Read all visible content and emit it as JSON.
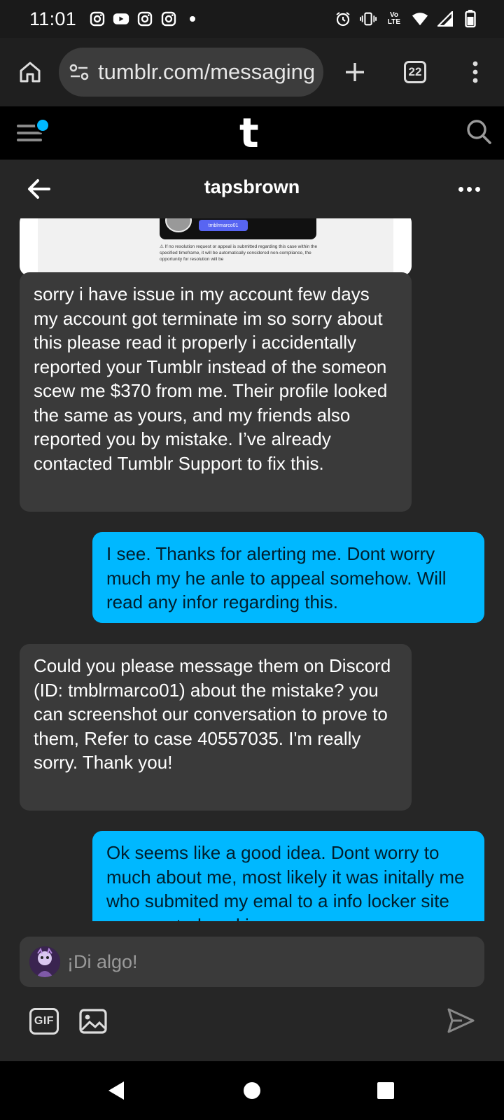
{
  "status_bar": {
    "time": "11:01",
    "left_icons": [
      "instagram-icon",
      "youtube-icon",
      "instagram-icon",
      "instagram-icon",
      "dot-icon"
    ],
    "right_icons": [
      "alarm-icon",
      "vibrate-icon",
      "volte-icon",
      "wifi-icon",
      "signal-icon",
      "battery-icon"
    ],
    "volte_text": "Vo LTE"
  },
  "browser": {
    "url": "tumblr.com/messaging",
    "tab_count": "22",
    "icons": [
      "home-icon",
      "site-settings-icon",
      "new-tab-icon",
      "tabs-icon",
      "more-vert-icon"
    ]
  },
  "tumblr_header": {
    "logo": "t",
    "has_notification": true,
    "accent_color": "#00b8ff"
  },
  "conversation": {
    "title": "tapsbrown"
  },
  "shared_image": {
    "tag_text": "tmblrmarco01",
    "caption": "⚠ If no resolution request or appeal is submitted regarding this case within the specified timeframe, it will be automatically considered non-compliance, the opportunity for resolution will be"
  },
  "messages": [
    {
      "direction": "incoming",
      "text": "sorry i have issue in my account few days my account got terminate im so sorry about this please read it properly i accidentally reported your Tumblr instead of the someon scew me $370 from me. Their profile looked the same as yours, and my friends also reported you by mistake. I’ve already contacted Tumblr Support to fix this."
    },
    {
      "direction": "outgoing",
      "text": "I see. Thanks for alerting me. Dont worry much my he anle to appeal somehow. Will read any infor regarding this."
    },
    {
      "direction": "incoming",
      "text": "Could you please message them on Discord (ID: tmblrmarco01) about the mistake? you can screenshot our conversation to prove to them, Refer to case 40557035. I'm really sorry. Thank you!"
    },
    {
      "direction": "outgoing",
      "text": "Ok seems like a good idea. Dont worry to much about me, most likely it was initally me who submited my emal to a info locker site or accepted cookies"
    }
  ],
  "composer": {
    "placeholder": "¡Di algo!",
    "gif_label": "GIF"
  },
  "nav_bar": {
    "icons": [
      "back-triangle-icon",
      "home-circle-icon",
      "recents-square-icon"
    ]
  }
}
